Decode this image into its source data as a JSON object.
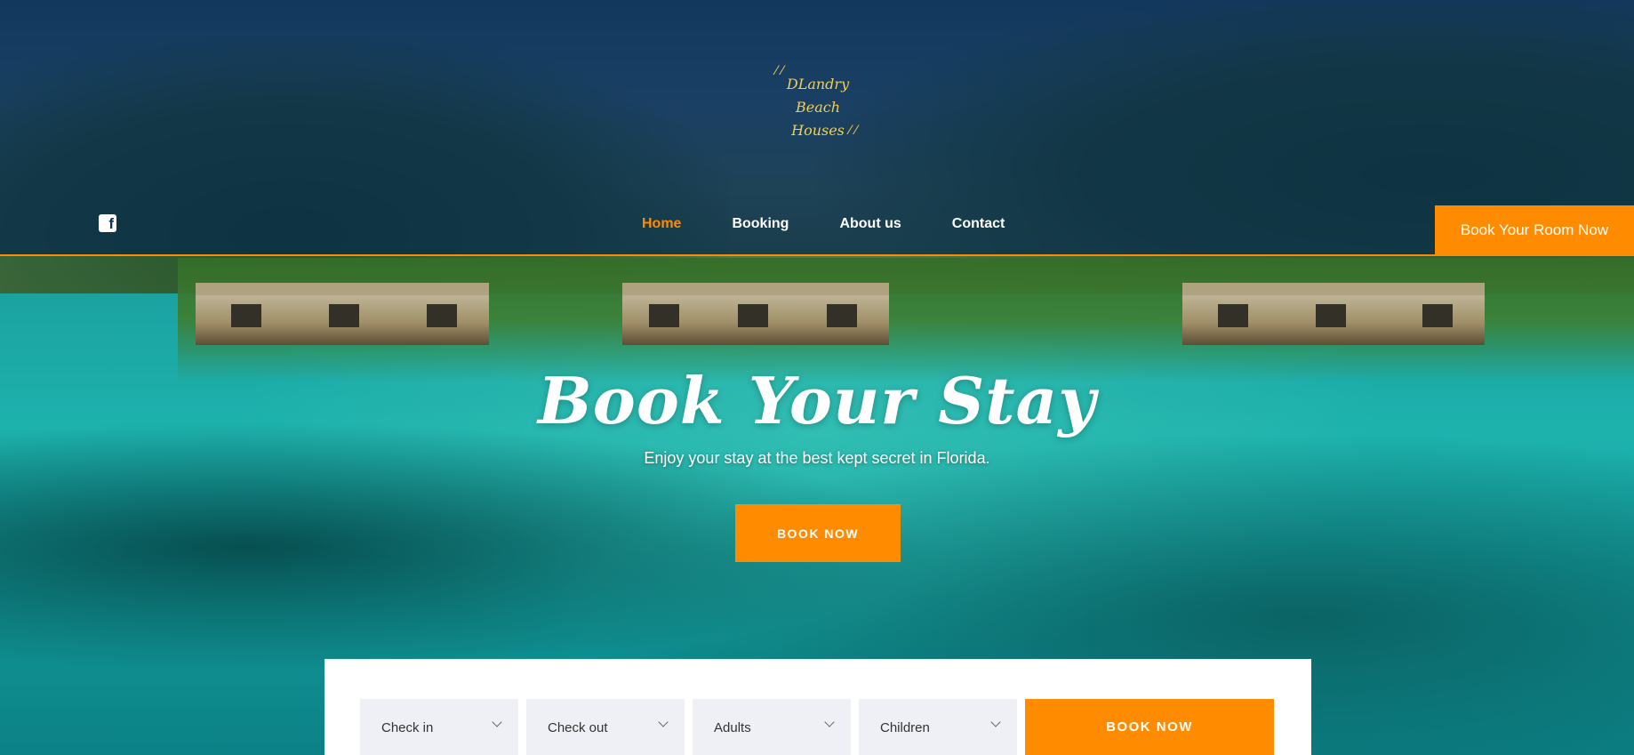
{
  "logo": {
    "line1": "DLandry Beach",
    "line2": "Houses"
  },
  "social": {
    "facebook_icon": "facebook-icon"
  },
  "nav": {
    "items": [
      {
        "label": "Home",
        "active": true
      },
      {
        "label": "Booking",
        "active": false
      },
      {
        "label": "About us",
        "active": false
      },
      {
        "label": "Contact",
        "active": false
      }
    ]
  },
  "header_cta": "Book Your Room Now",
  "hero": {
    "title": "Book Your Stay",
    "subtitle": "Enjoy your stay at the best kept secret in Florida.",
    "button": "BOOK NOW"
  },
  "booking": {
    "fields": [
      {
        "label": "Check in"
      },
      {
        "label": "Check out"
      },
      {
        "label": "Adults"
      },
      {
        "label": "Children"
      }
    ],
    "button": "BOOK NOW"
  },
  "colors": {
    "accent": "#ff8c00",
    "header_overlay": "#05284f",
    "logo": "#f2d04f"
  }
}
